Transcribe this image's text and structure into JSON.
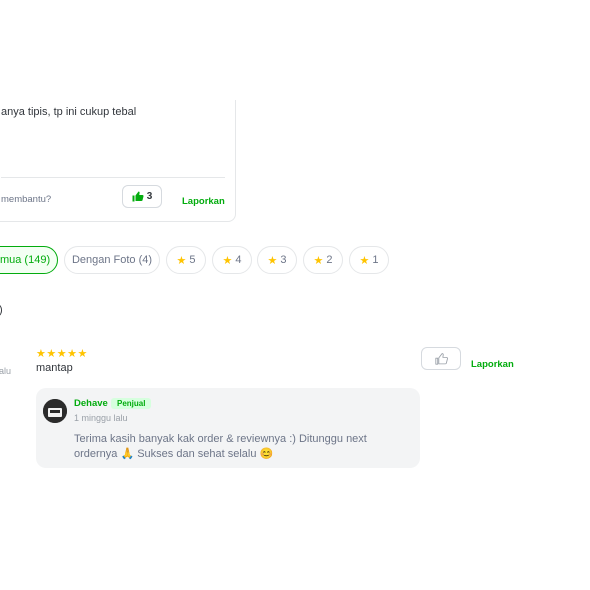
{
  "top_review": {
    "text": "anya tipis, tp ini cukup tebal",
    "helpful_question": "membantu?",
    "like_count": "3",
    "report_label": "Laporkan"
  },
  "filters": [
    {
      "label": "emua (149)",
      "active": true
    },
    {
      "label": "Dengan Foto (4)",
      "active": false
    },
    {
      "label": "5",
      "icon": "star-icon"
    },
    {
      "label": "4",
      "icon": "star-icon"
    },
    {
      "label": "3",
      "icon": "star-icon"
    },
    {
      "label": "2",
      "icon": "star-icon"
    },
    {
      "label": "1",
      "icon": "star-icon"
    }
  ],
  "summary_fragment": ")",
  "review": {
    "rating": 5,
    "time_fragment": "alu",
    "text": "mantap",
    "report_label": "Laporkan"
  },
  "reply": {
    "seller_name": "Dehave",
    "badge": "Penjual",
    "time": "1 minggu lalu",
    "text": "Terima kasih banyak kak order & reviewnya :) Ditunggu next ordernya 🙏 Sukses dan sehat selalu 😊"
  },
  "colors": {
    "accent": "#03ac0e",
    "star": "#ffc400"
  }
}
